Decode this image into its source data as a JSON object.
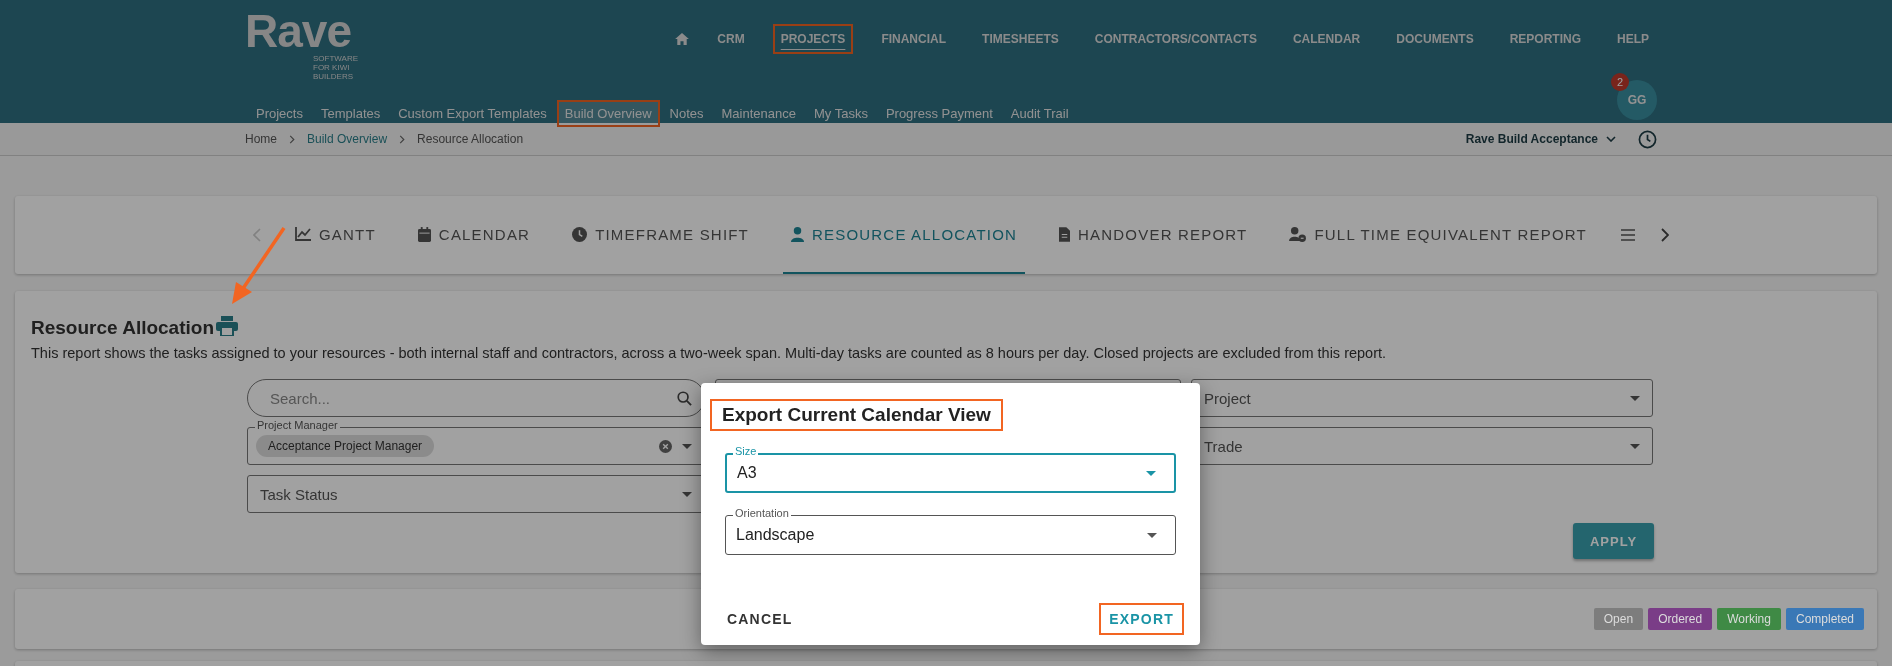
{
  "header": {
    "logo": "Rave",
    "tagline": "SOFTWARE FOR KIWI BUILDERS",
    "nav": [
      {
        "label": "CRM",
        "selected": false,
        "annotated": false
      },
      {
        "label": "PROJECTS",
        "selected": true,
        "annotated": true
      },
      {
        "label": "FINANCIAL",
        "selected": false,
        "annotated": false
      },
      {
        "label": "TIMESHEETS",
        "selected": false,
        "annotated": false
      },
      {
        "label": "CONTRACTORS/CONTACTS",
        "selected": false,
        "annotated": false
      },
      {
        "label": "CALENDAR",
        "selected": false,
        "annotated": false
      },
      {
        "label": "DOCUMENTS",
        "selected": false,
        "annotated": false
      },
      {
        "label": "REPORTING",
        "selected": false,
        "annotated": false
      },
      {
        "label": "HELP",
        "selected": false,
        "annotated": false
      }
    ],
    "subnav": [
      {
        "label": "Projects",
        "selected": false,
        "annotated": false
      },
      {
        "label": "Templates",
        "selected": false,
        "annotated": false
      },
      {
        "label": "Custom Export Templates",
        "selected": false,
        "annotated": false
      },
      {
        "label": "Build Overview",
        "selected": true,
        "annotated": true
      },
      {
        "label": "Notes",
        "selected": false,
        "annotated": false
      },
      {
        "label": "Maintenance",
        "selected": false,
        "annotated": false
      },
      {
        "label": "My Tasks",
        "selected": false,
        "annotated": false
      },
      {
        "label": "Progress Payment",
        "selected": false,
        "annotated": false
      },
      {
        "label": "Audit Trail",
        "selected": false,
        "annotated": false
      }
    ],
    "avatar": {
      "initials": "GG",
      "badge": "2"
    }
  },
  "breadcrumb": [
    "Home",
    "Build Overview",
    "Resource Allocation"
  ],
  "workspace": "Rave Build Acceptance",
  "tabs": [
    {
      "label": "GANTT",
      "selected": false
    },
    {
      "label": "CALENDAR",
      "selected": false
    },
    {
      "label": "TIMEFRAME SHIFT",
      "selected": false
    },
    {
      "label": "RESOURCE ALLOCATION",
      "selected": true
    },
    {
      "label": "HANDOVER REPORT",
      "selected": false
    },
    {
      "label": "FULL TIME EQUIVALENT REPORT",
      "selected": false
    }
  ],
  "report": {
    "title": "Resource Allocation",
    "description": "This report shows the tasks assigned to your resources - both internal staff and contractors, across a two-week span. Multi-day tasks are counted as 8 hours per day. Closed projects are excluded from this report.",
    "filters": [
      {
        "kind": "search",
        "placeholder": "Search..."
      },
      {
        "kind": "blank"
      },
      {
        "kind": "select",
        "placeholder": "Project"
      },
      {
        "kind": "chips",
        "label": "Project Manager",
        "chips": [
          "Acceptance Project Manager"
        ]
      },
      {
        "kind": "blank"
      },
      {
        "kind": "select",
        "placeholder": "Trade"
      },
      {
        "kind": "select",
        "placeholder": "Task Status"
      }
    ],
    "apply": "APPLY"
  },
  "legend": [
    {
      "label": "Open",
      "color": "#7d7d7d"
    },
    {
      "label": "Ordered",
      "color": "#7a3d87"
    },
    {
      "label": "Working",
      "color": "#3f8a45"
    },
    {
      "label": "Completed",
      "color": "#3a78b6"
    }
  ],
  "modal": {
    "title": "Export Current Calendar View",
    "title_annotated": true,
    "fields": [
      {
        "label": "Size",
        "value": "A3",
        "focused": true
      },
      {
        "label": "Orientation",
        "value": "Landscape",
        "focused": false
      }
    ],
    "cancel": "CANCEL",
    "export": "EXPORT",
    "export_annotated": true
  },
  "annotation_arrow": true
}
